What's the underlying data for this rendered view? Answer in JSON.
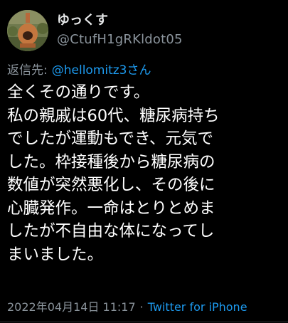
{
  "tweet": {
    "display_name": "ゆっくす",
    "handle": "@CtufH1gRKldot05",
    "avatar_icon": "avatar-chiminea-photo-icon",
    "reply_prefix": "返信先:",
    "reply_mention": "@hellomitz3さん",
    "body_lines": [
      "全くその通りです。",
      "私の親戚は60代、糖尿病持ち",
      "でしたが運動もでき、元気で",
      "した。枠接種後から糖尿病の",
      "数値が突然悪化し、その後に",
      "心臓発作。一命はとりとめま",
      "したが不自由な体になってし",
      "まいました。"
    ],
    "timestamp": "2022年04月14日 11:17",
    "separator": "·",
    "source": "Twitter for iPhone"
  },
  "colors": {
    "background": "#000000",
    "primary_text": "#ffffff",
    "secondary_text": "#8b949c",
    "accent_link": "#1d9bf0"
  }
}
